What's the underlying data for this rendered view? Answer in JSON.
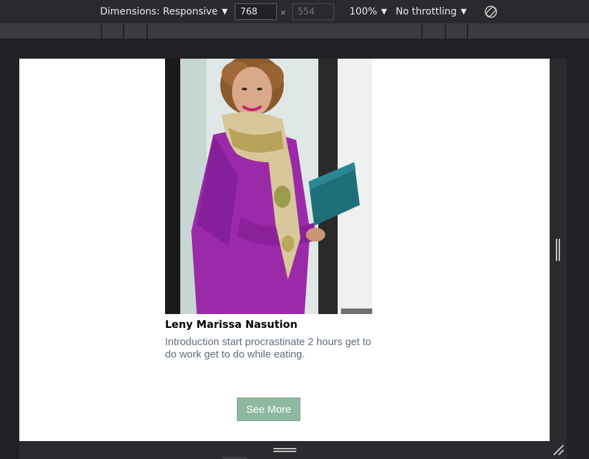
{
  "devtools": {
    "dimensions_label": "Dimensions: Responsive",
    "width_value": "768",
    "height_placeholder": "554",
    "times_symbol": "×",
    "zoom_label": "100%",
    "throttling_label": "No throttling",
    "caret": "▼"
  },
  "page": {
    "profile": {
      "name": "Leny Marissa Nasution",
      "intro": "Introduction start procrastinate 2 hours get to do work get to do while eating."
    },
    "see_more_label": "See More"
  },
  "colors": {
    "devtools_bg": "#292a2d",
    "button_bg": "#8fb8a1",
    "intro_text": "#5f6b7c",
    "dress": "#9b2aa8",
    "folder": "#1f6f7a"
  }
}
